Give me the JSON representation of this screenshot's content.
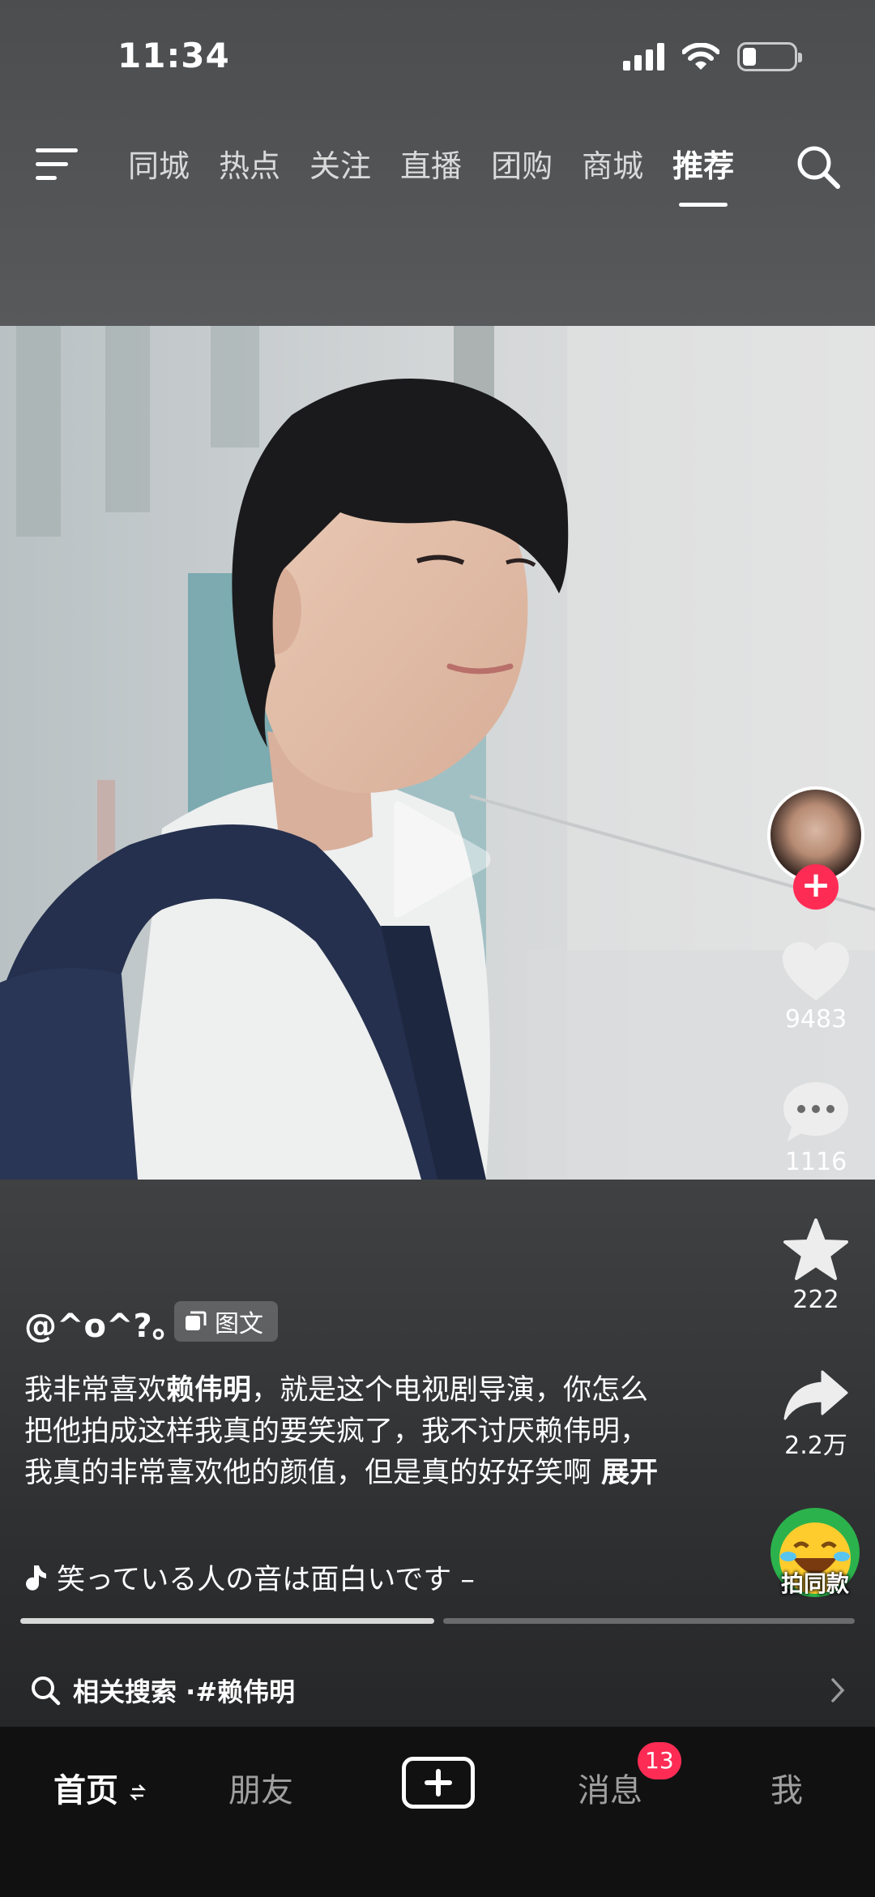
{
  "status": {
    "time": "11:34"
  },
  "top_nav": {
    "tabs": [
      "同城",
      "热点",
      "关注",
      "直播",
      "团购",
      "商城",
      "推荐"
    ],
    "active_tab": "推荐"
  },
  "post": {
    "author": "@^o^?。",
    "type_label": "图文",
    "caption_part1": "我非常喜欢",
    "caption_highlight": "赖伟明",
    "caption_part2": "，就是这个电视剧导演，你怎么把他拍成这样我真的要笑疯了，我不讨厌赖伟明，我真的非常喜欢他的颜值，但是真的好好笑啊",
    "expand_label": "展开",
    "music": "笑っている人の音は面白いです –",
    "images_viewed_fraction": 0.5
  },
  "actions": {
    "likes": "9483",
    "comments": "1116",
    "favorites": "222",
    "shares": "2.2万",
    "same_style_label": "拍同款"
  },
  "related_search": {
    "prefix": "相关搜索 · ",
    "term": "#赖伟明"
  },
  "bottom_nav": {
    "home": "首页",
    "friends": "朋友",
    "messages": "消息",
    "messages_badge": "13",
    "me": "我"
  },
  "colors": {
    "accent": "#fe2c55",
    "nav_bg": "#111111"
  }
}
